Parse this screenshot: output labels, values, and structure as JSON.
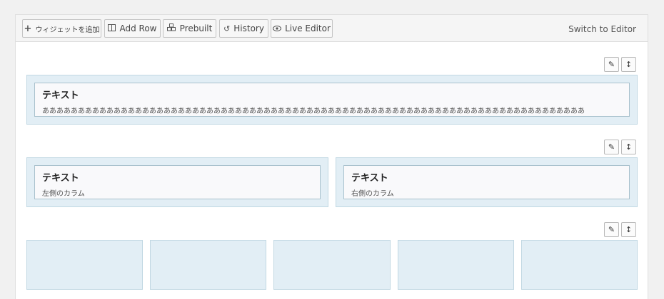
{
  "toolbar": {
    "add_widget_label": "ウィジェットを追加",
    "add_row_label": "Add Row",
    "prebuilt_label": "Prebuilt",
    "history_label": "History",
    "live_editor_label": "Live Editor",
    "switch_editor_label": "Switch to Editor"
  },
  "row_tools": {
    "settings_icon": "✎",
    "move_icon": "↕"
  },
  "rows": [
    {
      "widgets": [
        {
          "title": "テキスト",
          "description": "ああああああああああああああああああああああああああああああああああああああああああああああああああああああああああああああああああああああああああああ"
        }
      ]
    },
    {
      "widgets": [
        {
          "title": "テキスト",
          "description": "左側のカラム"
        },
        {
          "title": "テキスト",
          "description": "右側のカラム"
        }
      ]
    },
    {
      "cell_count": 5
    }
  ],
  "colors": {
    "cell_bg": "#e2eef5",
    "cell_border": "#c1d8e3",
    "widget_border": "#a9c1cd"
  }
}
